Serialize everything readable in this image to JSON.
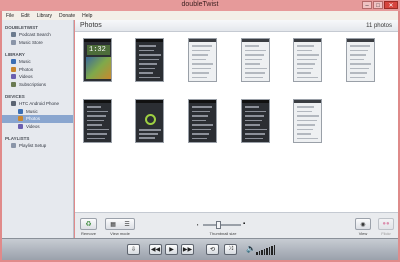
{
  "window": {
    "title": "doubleTwist",
    "min": "–",
    "max": "□",
    "close": "✕"
  },
  "menu": [
    "File",
    "Edit",
    "Library",
    "Donate",
    "Help"
  ],
  "sidebar": {
    "sections": [
      {
        "title": "DOUBLETWIST",
        "items": [
          {
            "label": "Podcast Search",
            "icon": "podcast-search-icon",
            "color": "#6c7b8e"
          },
          {
            "label": "Music Store",
            "icon": "music-store-icon",
            "color": "#8a95a8"
          }
        ]
      },
      {
        "title": "LIBRARY",
        "items": [
          {
            "label": "Music",
            "icon": "music-icon",
            "color": "#3b6fb4"
          },
          {
            "label": "Photos",
            "icon": "photos-icon",
            "color": "#c9862e"
          },
          {
            "label": "Videos",
            "icon": "videos-icon",
            "color": "#6b5fb0"
          },
          {
            "label": "Subscriptions",
            "icon": "subscriptions-icon",
            "color": "#6a7a52"
          }
        ]
      },
      {
        "title": "DEVICES",
        "items": [
          {
            "label": "HTC Android Phone",
            "icon": "phone-icon",
            "color": "#5b6472"
          },
          {
            "label": "Music",
            "icon": "music-icon",
            "color": "#3b6fb4",
            "sub": true
          },
          {
            "label": "Photos",
            "icon": "photos-icon",
            "color": "#c9862e",
            "sub": true,
            "selected": true
          },
          {
            "label": "Videos",
            "icon": "videos-icon",
            "color": "#6b5fb0",
            "sub": true
          }
        ]
      },
      {
        "title": "PLAYLISTS",
        "items": [
          {
            "label": "Playlist Setup",
            "icon": "playlist-icon",
            "color": "#8a95a8"
          }
        ]
      }
    ]
  },
  "main": {
    "title": "Photos",
    "count": "11 photos",
    "thumbs": [
      {
        "style": "home",
        "text": "1:32"
      },
      {
        "style": "dark"
      },
      {
        "style": "light"
      },
      {
        "style": "light"
      },
      {
        "style": "light"
      },
      {
        "style": "light"
      },
      {
        "style": "dark"
      },
      {
        "style": "welcome"
      },
      {
        "style": "dark"
      },
      {
        "style": "dark"
      },
      {
        "style": "light"
      }
    ]
  },
  "bottom": {
    "remove_label": "Remove",
    "viewmode_label": "View mode",
    "thumbsize_label": "Thumbnail size",
    "view_label": "View",
    "flickr_label": "Flickr",
    "thumb_size_value": 0.4
  },
  "transport": {
    "sync": "⇩",
    "prev": "◀◀",
    "play": "▶",
    "next": "▶▶",
    "repeat": "⟲",
    "shuffle": "⤨",
    "volume": "🔈"
  }
}
